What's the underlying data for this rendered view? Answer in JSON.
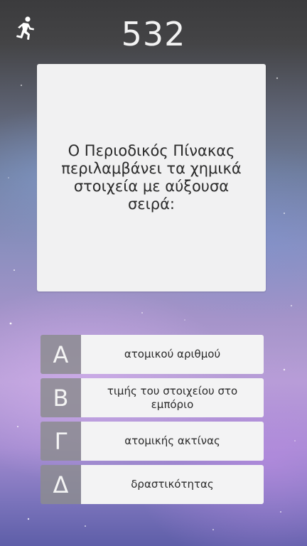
{
  "header": {
    "score": "532",
    "exit_icon": "running-man-icon"
  },
  "question": {
    "text": "Ο Περιοδικός Πίνακας περιλαμβάνει τα χημικά στοιχεία με αύξουσα σειρά:"
  },
  "answers": [
    {
      "letter": "Α",
      "text": "ατομικού αριθμού"
    },
    {
      "letter": "Β",
      "text": "τιμής του στοιχείου στο εμπόριο"
    },
    {
      "letter": "Γ",
      "text": "ατομικής ακτίνας"
    },
    {
      "letter": "Δ",
      "text": "δραστικότητας"
    }
  ],
  "colors": {
    "card_bg": "#f1f1f2",
    "letter_bg": "#8c8c91",
    "score_text": "#f2f2f2"
  }
}
